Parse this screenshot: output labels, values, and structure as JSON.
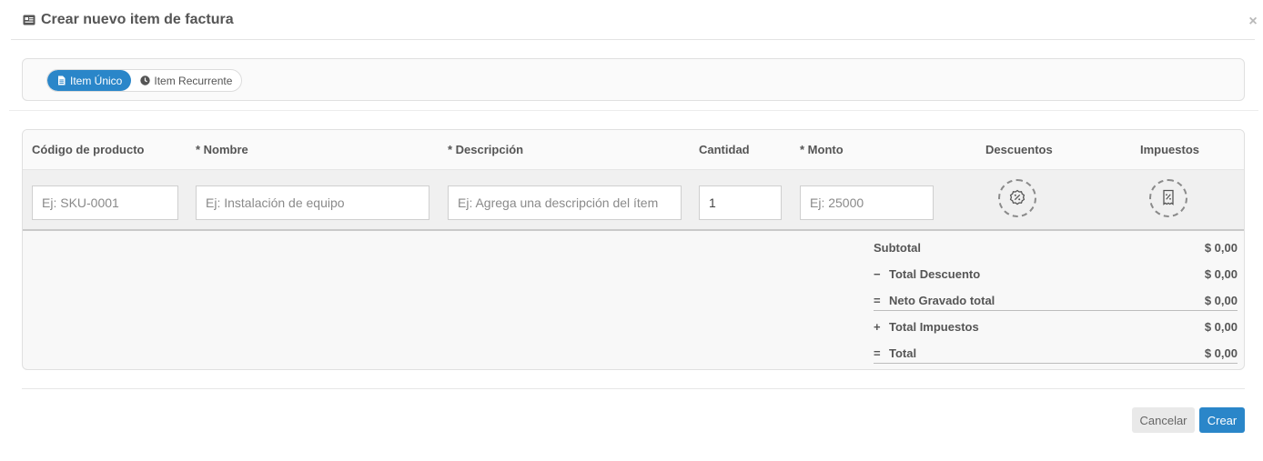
{
  "header": {
    "title": "Crear nuevo item de factura",
    "icon": "invoice-card-icon",
    "close_label": "×"
  },
  "item_type": {
    "options": [
      {
        "label": "Item Único",
        "icon": "document-icon",
        "active": true
      },
      {
        "label": "Item Recurrente",
        "icon": "clock-icon",
        "active": false
      }
    ]
  },
  "table": {
    "headers": {
      "code": "Código de producto",
      "name": "* Nombre",
      "description": "* Descripción",
      "quantity": "Cantidad",
      "amount": "* Monto",
      "discounts": "Descuentos",
      "taxes": "Impuestos"
    },
    "row": {
      "code_placeholder": "Ej: SKU-0001",
      "name_placeholder": "Ej: Instalación de equipo",
      "description_placeholder": "Ej: Agrega una descripción del ítem",
      "quantity_value": "1",
      "amount_placeholder": "Ej: 25000",
      "discount_icon": "discount-percent-icon",
      "tax_icon": "tax-receipt-icon"
    }
  },
  "totals": [
    {
      "sign": "",
      "label": "Subtotal",
      "value": "$ 0,00"
    },
    {
      "sign": "−",
      "label": "Total Descuento",
      "value": "$ 0,00"
    },
    {
      "sign": "=",
      "label": "Neto Gravado total",
      "value": "$ 0,00"
    },
    {
      "sign": "+",
      "label": "Total Impuestos",
      "value": "$ 0,00"
    },
    {
      "sign": "=",
      "label": "Total",
      "value": "$ 0,00"
    }
  ],
  "footer": {
    "cancel_label": "Cancelar",
    "create_label": "Crear"
  },
  "colors": {
    "accent": "#2a86c9"
  }
}
